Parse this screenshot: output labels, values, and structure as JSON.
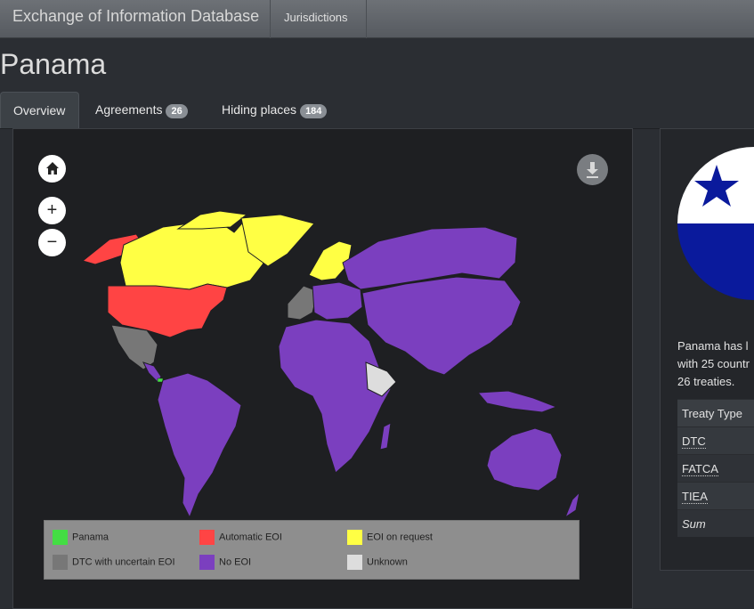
{
  "navbar": {
    "brand": "Exchange of Information Database",
    "jurisdictions_link": "Jurisdictions"
  },
  "page": {
    "title": "Panama"
  },
  "tabs": [
    {
      "label": "Overview",
      "active": true
    },
    {
      "label": "Agreements",
      "badge": "26"
    },
    {
      "label": "Hiding places",
      "badge": "184"
    }
  ],
  "map": {
    "controls": {
      "home_icon": "home-icon",
      "zoom_in": "+",
      "zoom_out": "−",
      "download_icon": "download-icon"
    },
    "legend": [
      {
        "label": "Panama",
        "color": "#44dd44"
      },
      {
        "label": "Automatic EOI",
        "color": "#ff4444"
      },
      {
        "label": "EOI on request",
        "color": "#ffff44"
      },
      {
        "label": "DTC with uncertain EOI",
        "color": "#777777"
      },
      {
        "label": "No EOI",
        "color": "#7b3fbf"
      },
      {
        "label": "Unknown",
        "color": "#dddddd"
      }
    ]
  },
  "info": {
    "flag_colors": {
      "white": "#ffffff",
      "blue": "#0a1a9c"
    },
    "text_lines": [
      "Panama has l",
      "with 25 countr",
      "26 treaties."
    ],
    "table": {
      "header": "Treaty Type",
      "rows": [
        "DTC",
        "FATCA",
        "TIEA"
      ],
      "sum_label": "Sum"
    }
  }
}
